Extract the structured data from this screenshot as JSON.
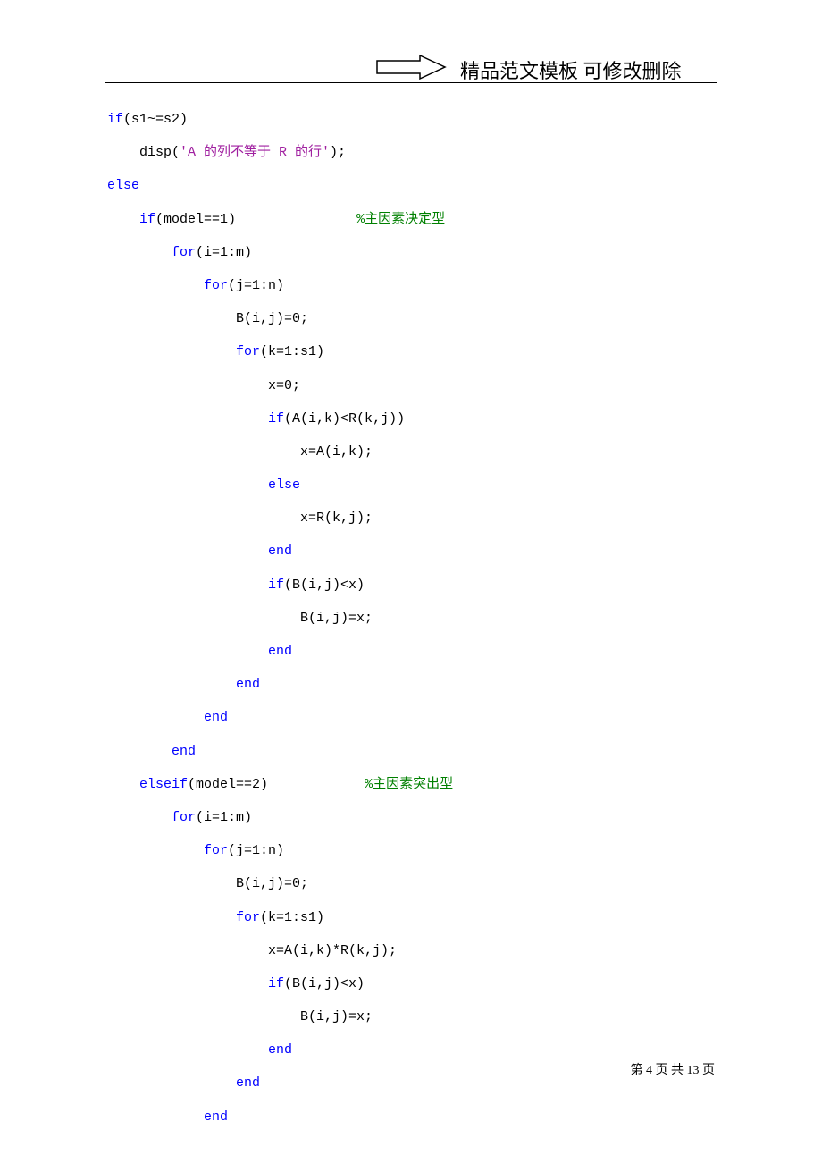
{
  "header": {
    "text": "精品范文模板  可修改删除"
  },
  "code": {
    "lines": [
      {
        "indent": 0,
        "segments": [
          {
            "type": "kw",
            "text": "if"
          },
          {
            "type": "plain",
            "text": "(s1~=s2)"
          }
        ]
      },
      {
        "indent": 1,
        "segments": [
          {
            "type": "plain",
            "text": "disp("
          },
          {
            "type": "str",
            "text": "'A 的列不等于 R 的行'"
          },
          {
            "type": "plain",
            "text": ");"
          }
        ]
      },
      {
        "indent": 0,
        "segments": [
          {
            "type": "kw",
            "text": "else"
          }
        ]
      },
      {
        "indent": 1,
        "segments": [
          {
            "type": "kw",
            "text": "if"
          },
          {
            "type": "plain",
            "text": "(model==1)               "
          },
          {
            "type": "cmt",
            "text": "%主因素决定型"
          }
        ]
      },
      {
        "indent": 2,
        "segments": [
          {
            "type": "kw",
            "text": "for"
          },
          {
            "type": "plain",
            "text": "(i=1:m)"
          }
        ]
      },
      {
        "indent": 3,
        "segments": [
          {
            "type": "kw",
            "text": "for"
          },
          {
            "type": "plain",
            "text": "(j=1:n)"
          }
        ]
      },
      {
        "indent": 4,
        "segments": [
          {
            "type": "plain",
            "text": "B(i,j)=0;"
          }
        ]
      },
      {
        "indent": 4,
        "segments": [
          {
            "type": "kw",
            "text": "for"
          },
          {
            "type": "plain",
            "text": "(k=1:s1)"
          }
        ]
      },
      {
        "indent": 5,
        "segments": [
          {
            "type": "plain",
            "text": "x=0;"
          }
        ]
      },
      {
        "indent": 5,
        "segments": [
          {
            "type": "kw",
            "text": "if"
          },
          {
            "type": "plain",
            "text": "(A(i,k)<R(k,j))"
          }
        ]
      },
      {
        "indent": 6,
        "segments": [
          {
            "type": "plain",
            "text": "x=A(i,k);"
          }
        ]
      },
      {
        "indent": 5,
        "segments": [
          {
            "type": "kw",
            "text": "else"
          }
        ]
      },
      {
        "indent": 6,
        "segments": [
          {
            "type": "plain",
            "text": "x=R(k,j);"
          }
        ]
      },
      {
        "indent": 5,
        "segments": [
          {
            "type": "kw",
            "text": "end"
          }
        ]
      },
      {
        "indent": 5,
        "segments": [
          {
            "type": "kw",
            "text": "if"
          },
          {
            "type": "plain",
            "text": "(B(i,j)<x)"
          }
        ]
      },
      {
        "indent": 6,
        "segments": [
          {
            "type": "plain",
            "text": "B(i,j)=x;"
          }
        ]
      },
      {
        "indent": 5,
        "segments": [
          {
            "type": "kw",
            "text": "end"
          }
        ]
      },
      {
        "indent": 4,
        "segments": [
          {
            "type": "kw",
            "text": "end"
          }
        ]
      },
      {
        "indent": 3,
        "segments": [
          {
            "type": "kw",
            "text": "end"
          }
        ]
      },
      {
        "indent": 2,
        "segments": [
          {
            "type": "kw",
            "text": "end"
          }
        ]
      },
      {
        "indent": 1,
        "segments": [
          {
            "type": "kw",
            "text": "elseif"
          },
          {
            "type": "plain",
            "text": "(model==2)            "
          },
          {
            "type": "cmt",
            "text": "%主因素突出型"
          }
        ]
      },
      {
        "indent": 2,
        "segments": [
          {
            "type": "kw",
            "text": "for"
          },
          {
            "type": "plain",
            "text": "(i=1:m)"
          }
        ]
      },
      {
        "indent": 3,
        "segments": [
          {
            "type": "kw",
            "text": "for"
          },
          {
            "type": "plain",
            "text": "(j=1:n)"
          }
        ]
      },
      {
        "indent": 4,
        "segments": [
          {
            "type": "plain",
            "text": "B(i,j)=0;"
          }
        ]
      },
      {
        "indent": 4,
        "segments": [
          {
            "type": "kw",
            "text": "for"
          },
          {
            "type": "plain",
            "text": "(k=1:s1)"
          }
        ]
      },
      {
        "indent": 5,
        "segments": [
          {
            "type": "plain",
            "text": "x=A(i,k)*R(k,j);"
          }
        ]
      },
      {
        "indent": 5,
        "segments": [
          {
            "type": "kw",
            "text": "if"
          },
          {
            "type": "plain",
            "text": "(B(i,j)<x)"
          }
        ]
      },
      {
        "indent": 6,
        "segments": [
          {
            "type": "plain",
            "text": "B(i,j)=x;"
          }
        ]
      },
      {
        "indent": 5,
        "segments": [
          {
            "type": "kw",
            "text": "end"
          }
        ]
      },
      {
        "indent": 4,
        "segments": [
          {
            "type": "kw",
            "text": "end"
          }
        ]
      },
      {
        "indent": 3,
        "segments": [
          {
            "type": "kw",
            "text": "end"
          }
        ]
      }
    ]
  },
  "footer": {
    "text": "第 4 页 共 13 页",
    "current_page": 4,
    "total_pages": 13
  }
}
